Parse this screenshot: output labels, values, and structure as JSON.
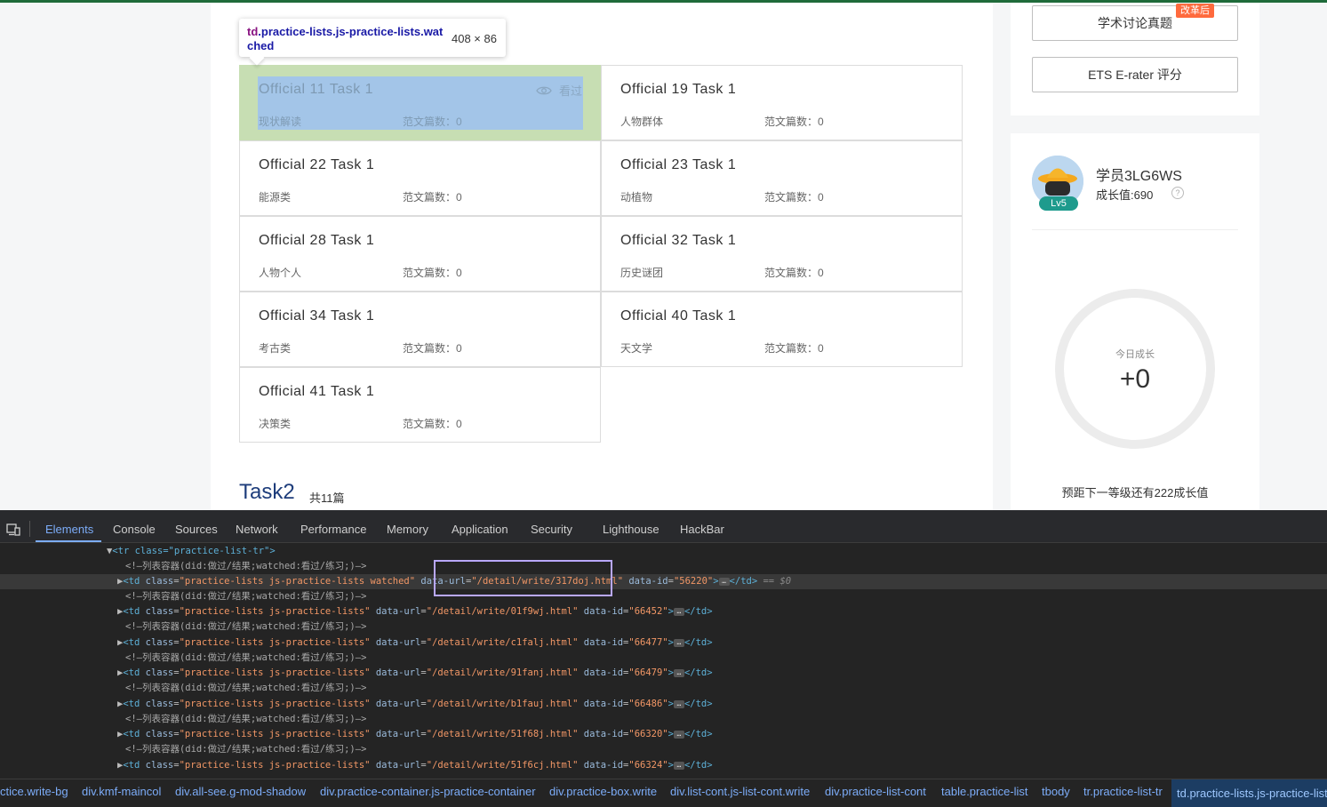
{
  "tooltip": {
    "tag": "td",
    "selector_rest": ".practice-lists.js-practice-lists.watched",
    "dimensions": "408 × 86"
  },
  "practice_items": [
    {
      "title": "Official 11 Task 1",
      "tag": "现状解读",
      "count": "范文篇数：0",
      "watched": "看过"
    },
    {
      "title": "Official 19 Task 1",
      "tag": "人物群体",
      "count": "范文篇数：0"
    },
    {
      "title": "Official 22 Task 1",
      "tag": "能源类",
      "count": "范文篇数：0"
    },
    {
      "title": "Official 23 Task 1",
      "tag": "动植物",
      "count": "范文篇数：0"
    },
    {
      "title": "Official 28 Task 1",
      "tag": "人物个人",
      "count": "范文篇数：0"
    },
    {
      "title": "Official 32 Task 1",
      "tag": "历史谜团",
      "count": "范文篇数：0"
    },
    {
      "title": "Official 34 Task 1",
      "tag": "考古类",
      "count": "范文篇数：0"
    },
    {
      "title": "Official 40 Task 1",
      "tag": "天文学",
      "count": "范文篇数：0"
    },
    {
      "title": "Official 41 Task 1",
      "tag": "决策类",
      "count": "范文篇数：0"
    }
  ],
  "section": {
    "title": "Task2",
    "count": "共11篇"
  },
  "sidebar": {
    "btn_discussion": "学术讨论真题",
    "badge": "改革后",
    "btn_erater": "ETS E-rater 评分",
    "user_name": "学员3LG6WS",
    "growth": "成长值:690",
    "level": "Lv5",
    "today_label": "今日成长",
    "today_value": "+0",
    "next_level": "预距下一等级还有222成长值"
  },
  "devtools": {
    "tabs": [
      "Elements",
      "Console",
      "Sources",
      "Network",
      "Performance",
      "Memory",
      "Application",
      "Security",
      "Lighthouse",
      "HackBar"
    ],
    "tree": {
      "tr_line": "<tr class=\"practice-list-tr\">",
      "comment": "<!—列表容器(did:做过/结果;watched:看过/练习;)—>",
      "selected_td_class": "practice-lists js-practice-lists watched",
      "selected_url": "/detail/write/317doj.html",
      "selected_id": "56220",
      "selected_suffix": "== $0",
      "rows": [
        {
          "url": "/detail/write/01f9wj.html",
          "id": "66452"
        },
        {
          "url": "/detail/write/c1falj.html",
          "id": "66477"
        },
        {
          "url": "/detail/write/91fanj.html",
          "id": "66479"
        },
        {
          "url": "/detail/write/b1fauj.html",
          "id": "66486"
        },
        {
          "url": "/detail/write/51f68j.html",
          "id": "66320"
        },
        {
          "url": "/detail/write/51f6cj.html",
          "id": "66324"
        }
      ]
    },
    "breadcrumbs": [
      "ctice.write-bg",
      "div.kmf-maincol",
      "div.all-see.g-mod-shadow",
      "div.practice-container.js-practice-container",
      "div.practice-box.write",
      "div.list-cont.js-list-cont.write",
      "div.practice-list-cont",
      "table.practice-list",
      "tbody",
      "tr.practice-list-tr",
      "td.practice-lists.js-practice-lists"
    ]
  },
  "colors": {
    "accent": "#7cacf8",
    "highlight_bg": "#c7deb3",
    "selection": "#a3c5e8",
    "devtools_bg": "#242424"
  }
}
